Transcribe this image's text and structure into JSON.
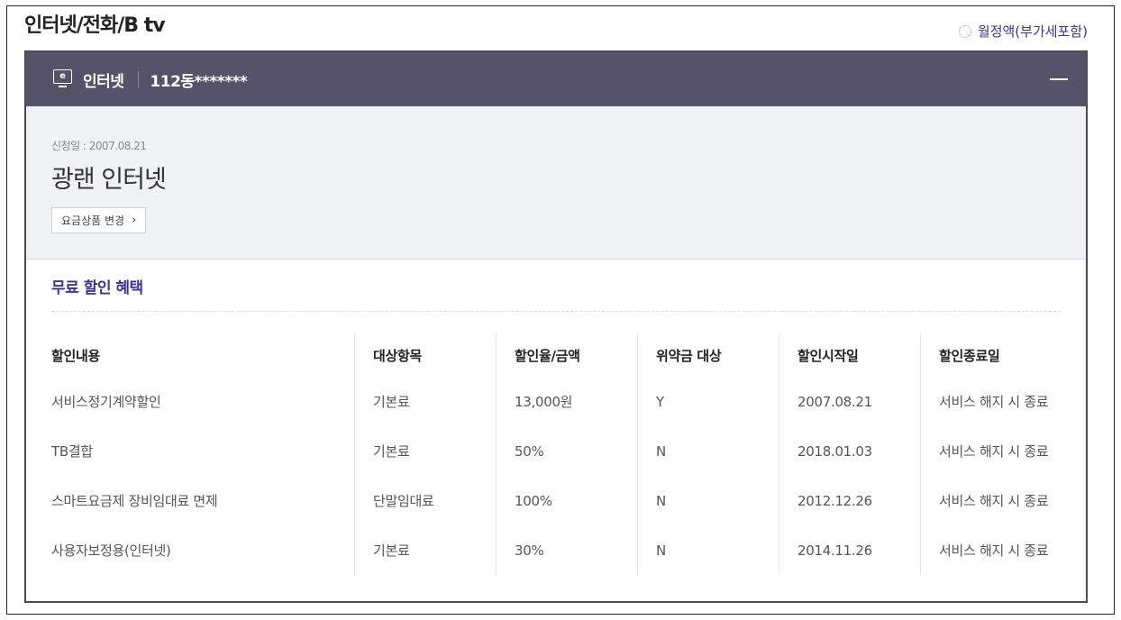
{
  "page": {
    "title": "인터넷/전화/B tv",
    "monthly_label": "월정액(부가세포함)"
  },
  "service": {
    "icon_letter": "e",
    "type": "인터넷",
    "id": "112동*******"
  },
  "plan": {
    "apply_date": "신청일 : 2007.08.21",
    "name": "광랜 인터넷",
    "change_button": "요금상품 변경"
  },
  "discount": {
    "title": "무료 할인 혜택",
    "headers": [
      "할인내용",
      "대상항목",
      "할인율/금액",
      "위약금 대상",
      "할인시작일",
      "할인종료일"
    ],
    "rows": [
      [
        "서비스정기계약할인",
        "기본료",
        "13,000원",
        "Y",
        "2007.08.21",
        "서비스 해지 시 종료"
      ],
      [
        "TB결합",
        "기본료",
        "50%",
        "N",
        "2018.01.03",
        "서비스 해지 시 종료"
      ],
      [
        "스마트요금제 장비임대료 면제",
        "단말임대료",
        "100%",
        "N",
        "2012.12.26",
        "서비스 해지 시 종료"
      ],
      [
        "사용자보정용(인터넷)",
        "기본료",
        "30%",
        "N",
        "2014.11.26",
        "서비스 해지 시 종료"
      ]
    ]
  }
}
